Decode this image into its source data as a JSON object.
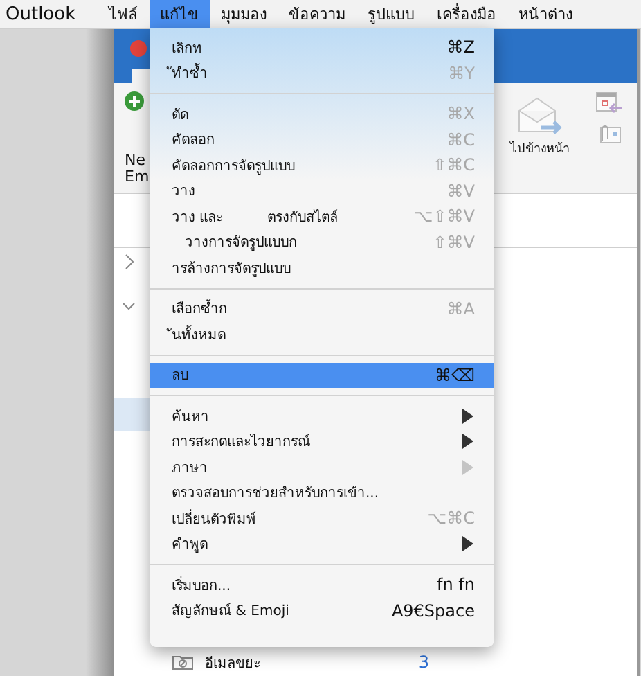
{
  "menu_bar": {
    "app": "Outlook",
    "menus": [
      {
        "label": "ไฟล์",
        "selected": false
      },
      {
        "label": "แก้ไข",
        "selected": true
      },
      {
        "label": "มุมมอง",
        "selected": false
      },
      {
        "label": "ข้อความ",
        "selected": false
      },
      {
        "label": "รูปแบบ",
        "selected": false
      },
      {
        "label": "เครื่องมือ",
        "selected": false
      },
      {
        "label": "หน้าต่าง",
        "selected": false
      }
    ]
  },
  "window": {
    "ribbon": {
      "new_label": [
        "Ne",
        "Em"
      ],
      "forward_label": "ไปข้างหน้า"
    },
    "sidebar": {
      "expanders": [
        {
          "expanded": false
        },
        {
          "expanded": true
        }
      ],
      "folder": {
        "name": "อีเมลขยะ",
        "count": "3"
      }
    }
  },
  "edit_menu": [
    {
      "kind": "item",
      "label": "เลิกท",
      "shortcut": "⌘Z",
      "enabled": true,
      "selected": false
    },
    {
      "kind": "item",
      "label": "ัทำซ้ำ",
      "shortcut": "⌘Y",
      "enabled": false,
      "selected": false
    },
    {
      "kind": "separator"
    },
    {
      "kind": "item",
      "label": "ตัด",
      "shortcut": "⌘X",
      "enabled": false,
      "selected": false
    },
    {
      "kind": "item",
      "label": "คัดลอก",
      "shortcut": "⌘C",
      "enabled": false,
      "selected": false
    },
    {
      "kind": "item",
      "label": "คัดลอกการจัดรูปแบบ",
      "shortcut": "⇧⌘C",
      "enabled": false,
      "selected": false
    },
    {
      "kind": "item",
      "label": "วาง",
      "shortcut": "⌘V",
      "enabled": false,
      "selected": false
    },
    {
      "kind": "item",
      "label": "วาง และ          ตรงกับสไตล์",
      "shortcut": "⌥⇧⌘V",
      "enabled": false,
      "selected": false
    },
    {
      "kind": "item",
      "label": "   วางการจัดรูปแบบก",
      "shortcut": "⇧⌘V",
      "enabled": false,
      "selected": false
    },
    {
      "kind": "item",
      "label": "ารล้างการจัดรูปแบบ",
      "selected": false
    },
    {
      "kind": "separator"
    },
    {
      "kind": "item",
      "label": "เลือกซ้ำก",
      "shortcut": "⌘A",
      "enabled": false,
      "selected": false
    },
    {
      "kind": "item",
      "label": "ันทั้งหมด",
      "selected": false
    },
    {
      "kind": "separator"
    },
    {
      "kind": "item",
      "label": "ลบ",
      "shortcut": "⌘⌫",
      "enabled": true,
      "selected": true
    },
    {
      "kind": "separator"
    },
    {
      "kind": "submenu",
      "label": "ค้นหา",
      "enabled": true,
      "selected": false
    },
    {
      "kind": "submenu",
      "label": "การสะกดและไวยากรณ์",
      "enabled": true,
      "selected": false
    },
    {
      "kind": "submenu",
      "label": "ภาษา",
      "enabled": false,
      "selected": false
    },
    {
      "kind": "item",
      "label": "ตรวจสอบการช่วยสำหรับการเข้า...",
      "selected": false
    },
    {
      "kind": "item",
      "label": "เปลี่ยนตัวพิมพ์",
      "shortcut": "⌥⌘C",
      "enabled": false,
      "selected": false
    },
    {
      "kind": "submenu",
      "label": "คำพูด",
      "enabled": true,
      "selected": false
    },
    {
      "kind": "separator"
    },
    {
      "kind": "item",
      "label": "เริ่มบอก...",
      "shortcut": "fn fn",
      "enabled": true,
      "selected": false
    },
    {
      "kind": "item",
      "label": "สัญลักษณ์ & Emoji",
      "shortcut": "A9€Space",
      "enabled": true,
      "selected": false
    }
  ]
}
